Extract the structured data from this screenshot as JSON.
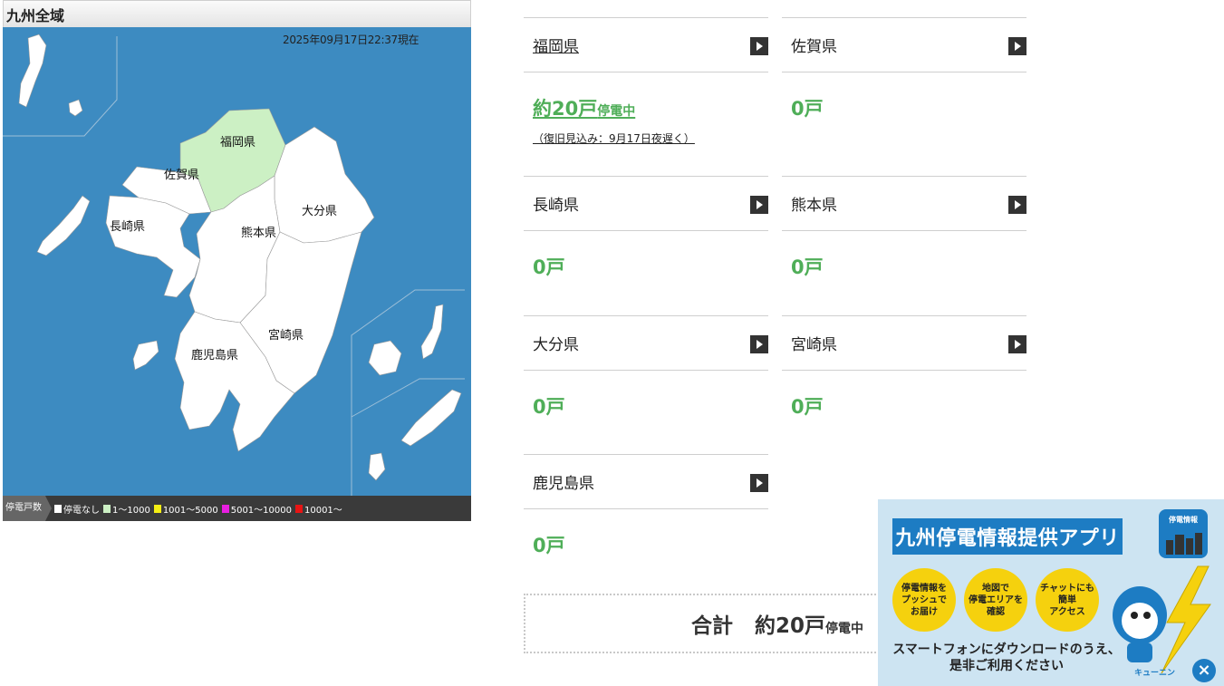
{
  "map": {
    "title": "九州全域",
    "timestamp": "2025年09月17日22:37現在",
    "ocean_color": "#3d8bc1",
    "land_color": "#ffffff",
    "affected_color": "#ccf0c4",
    "labels": {
      "fukuoka": "福岡県",
      "saga": "佐賀県",
      "nagasaki": "長崎県",
      "kumamoto": "熊本県",
      "oita": "大分県",
      "miyazaki": "宮崎県",
      "kagoshima": "鹿児島県"
    },
    "legend": {
      "title": "停電戸数",
      "items": [
        {
          "label": "停電なし",
          "color": "#ffffff"
        },
        {
          "label": "1～1000",
          "color": "#ccf0c4"
        },
        {
          "label": "1001～5000",
          "color": "#f5ee14"
        },
        {
          "label": "5001～10000",
          "color": "#e81ee0"
        },
        {
          "label": "10001～",
          "color": "#e81414"
        }
      ]
    }
  },
  "prefectures": [
    {
      "name": "福岡県",
      "count": "約20戸",
      "status": "停電中",
      "recovery": "（復旧見込み：9月17日夜遅く）"
    },
    {
      "name": "佐賀県",
      "count": "0戸"
    },
    {
      "name": "長崎県",
      "count": "0戸"
    },
    {
      "name": "熊本県",
      "count": "0戸"
    },
    {
      "name": "大分県",
      "count": "0戸"
    },
    {
      "name": "宮崎県",
      "count": "0戸"
    },
    {
      "name": "鹿児島県",
      "count": "0戸"
    }
  ],
  "total": {
    "label": "合計",
    "count": "約20戸",
    "status": "停電中"
  },
  "banner": {
    "title": "九州停電情報提供アプリ",
    "icon_label": "停電情報",
    "features": [
      "停電情報を\nプッシュで\nお届け",
      "地図で\n停電エリアを\n確認",
      "チャットにも\n簡単\nアクセス"
    ],
    "text": "スマートフォンにダウンロードのうえ、\n是非ご利用ください",
    "mascot_name": "キューニン",
    "close": "×",
    "accent_color": "#1d7cc3",
    "bubble_color": "#f5d10e"
  }
}
